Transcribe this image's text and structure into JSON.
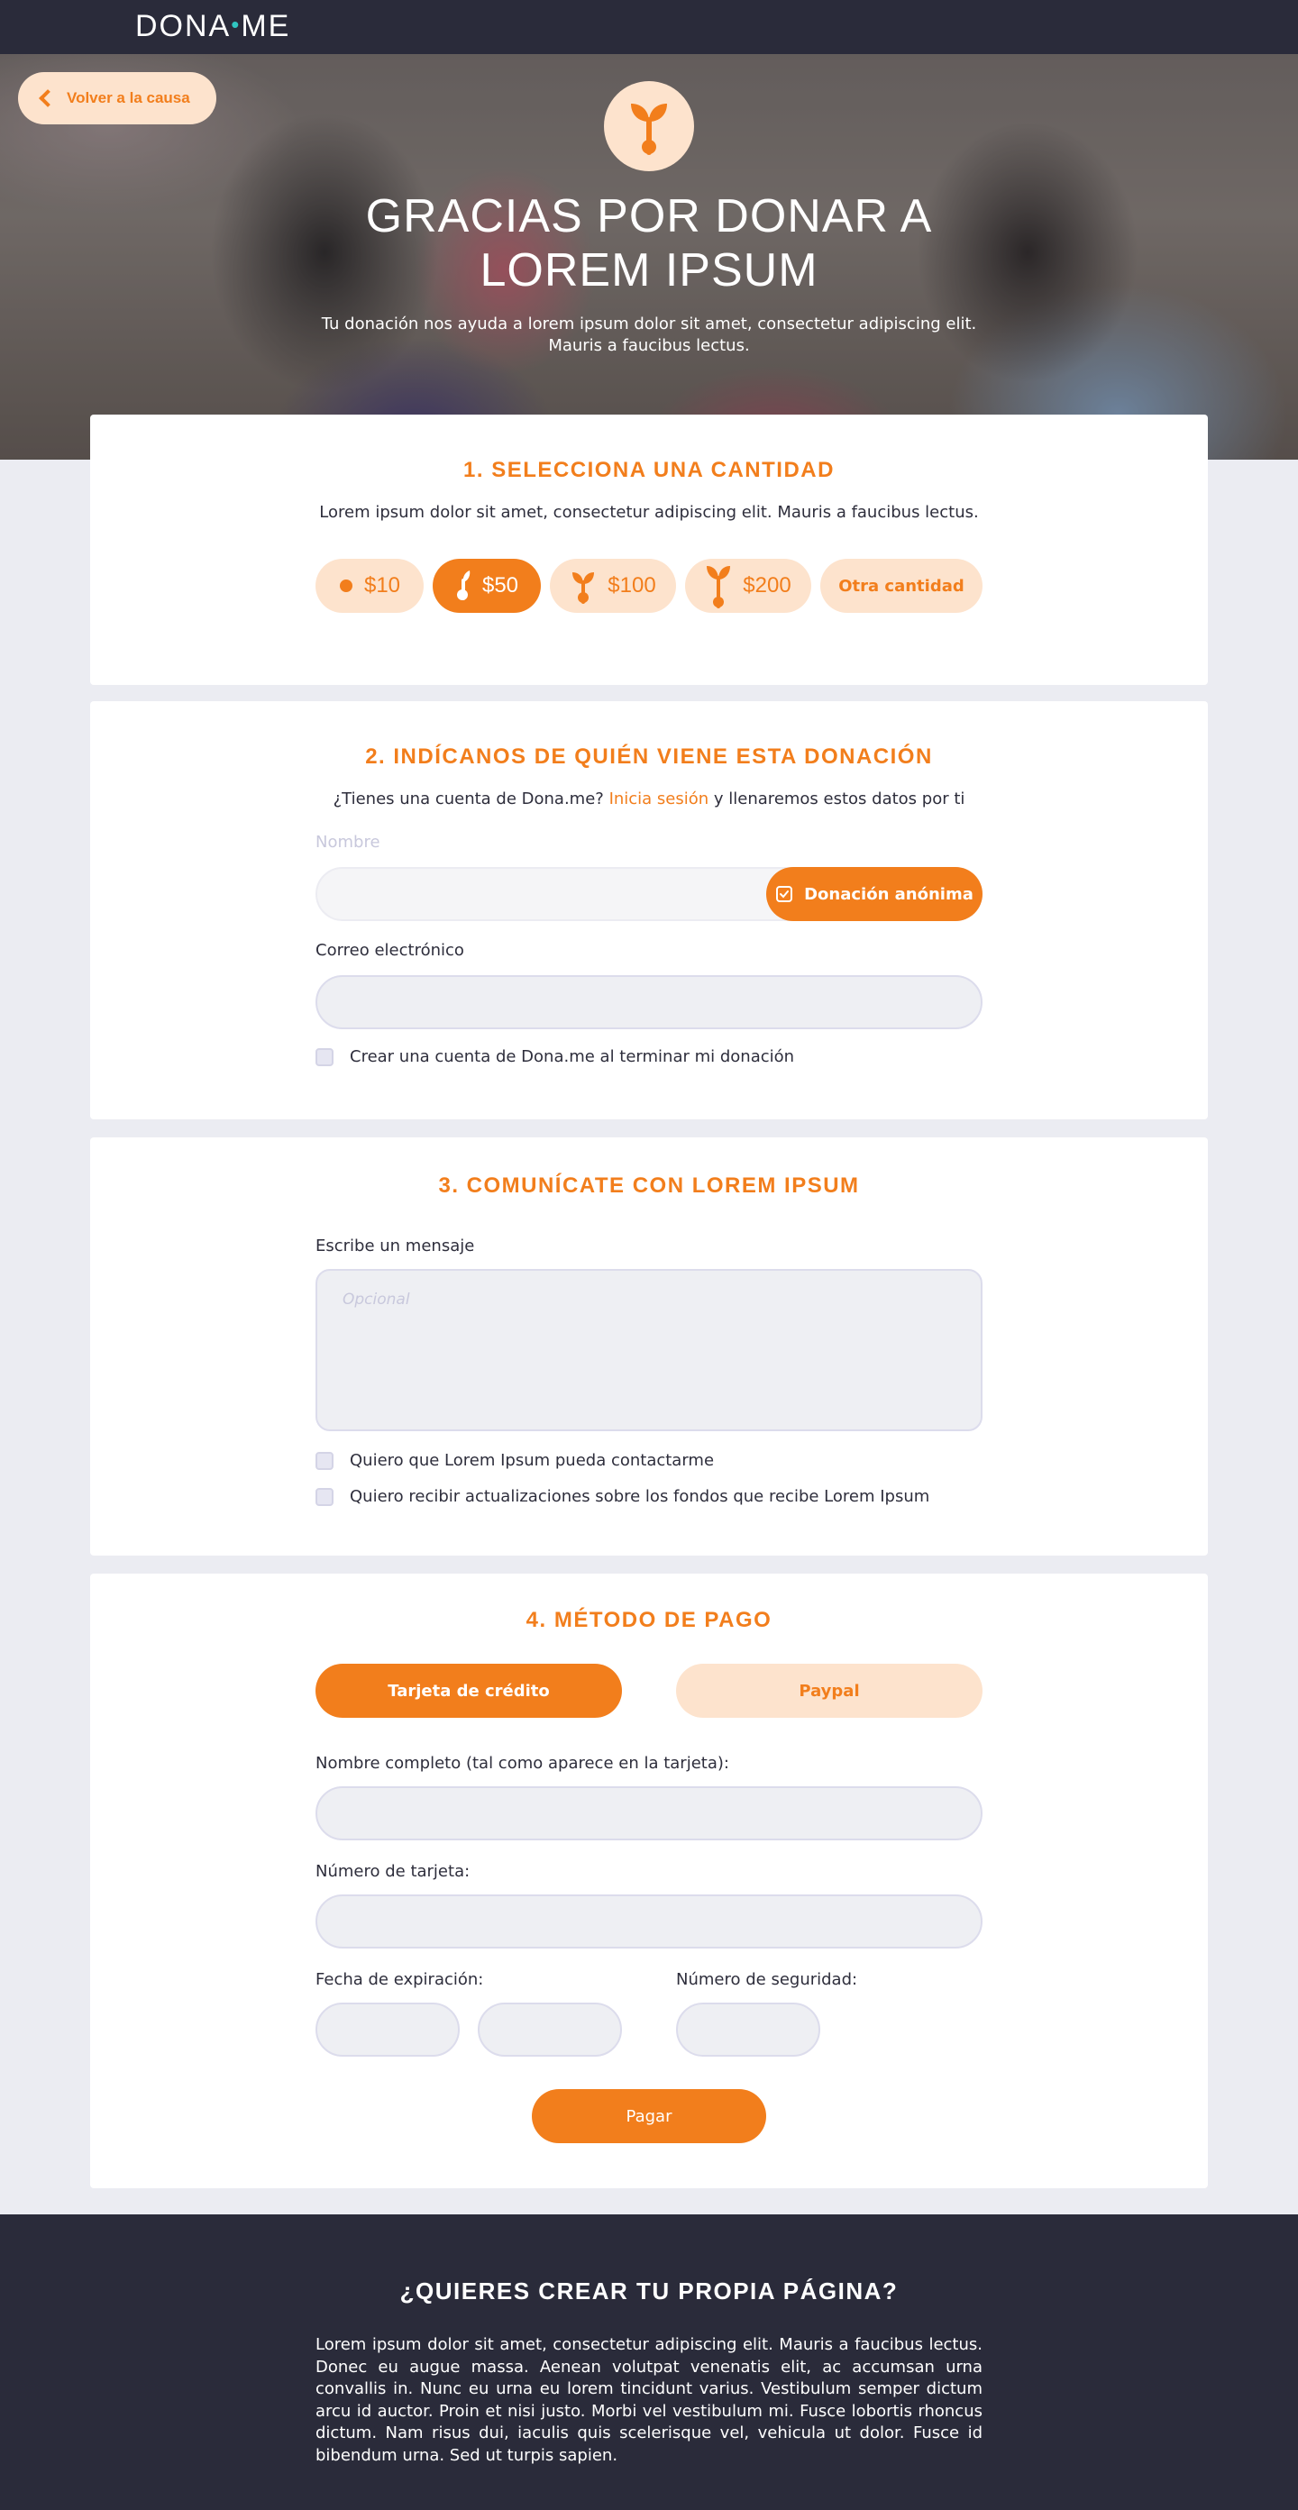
{
  "header": {
    "logo_left": "DONA",
    "logo_dot": "•",
    "logo_right": "ME"
  },
  "hero": {
    "back_label": "Volver a la causa",
    "title": "GRACIAS POR DONAR A LOREM IPSUM",
    "subtitle": "Tu donación nos ayuda a lorem ipsum dolor sit amet, consectetur adipiscing elit. Mauris a faucibus lectus."
  },
  "section1": {
    "title": "1. SELECCIONA UNA CANTIDAD",
    "text": "Lorem ipsum dolor sit amet, consectetur adipiscing elit. Mauris a faucibus lectus.",
    "amounts": [
      {
        "label": "$10",
        "icon": "seed-icon",
        "active": false
      },
      {
        "label": "$50",
        "icon": "sprout-icon",
        "active": true
      },
      {
        "label": "$100",
        "icon": "seedling-icon",
        "active": false
      },
      {
        "label": "$200",
        "icon": "plant-icon",
        "active": false
      }
    ],
    "other_label": "Otra cantidad"
  },
  "section2": {
    "title": "2. INDÍCANOS DE QUIÉN VIENE ESTA DONACIÓN",
    "question": "¿Tienes una cuenta de Dona.me?",
    "login_link": "Inicia sesión",
    "question_end": "y llenaremos estos datos por ti",
    "name_label": "Nombre",
    "anon_label": "Donación anónima",
    "email_label": "Correo electrónico",
    "create_account_label": "Crear una cuenta de Dona.me al terminar mi donación"
  },
  "section3": {
    "title": "3. COMUNÍCATE CON LOREM IPSUM",
    "message_label": "Escribe un mensaje",
    "message_placeholder": "Opcional",
    "contact_label": "Quiero que Lorem Ipsum pueda contactarme",
    "updates_label": "Quiero recibir actualizaciones sobre los fondos que recibe Lorem Ipsum"
  },
  "section4": {
    "title": "4. MÉTODO DE PAGO",
    "tab_card": "Tarjeta de crédito",
    "tab_paypal": "Paypal",
    "fullname_label": "Nombre completo (tal como aparece en la tarjeta):",
    "cardnumber_label": "Número de tarjeta:",
    "expiry_label": "Fecha de expiración:",
    "security_label": "Número de seguridad:",
    "pay_label": "Pagar"
  },
  "footer": {
    "title": "¿QUIERES CREAR TU PROPIA PÁGINA?",
    "text": "Lorem ipsum dolor sit amet, consectetur adipiscing elit. Mauris a faucibus lectus. Donec eu augue massa. Aenean volutpat venenatis elit, ac accumsan urna convallis in. Nunc eu urna eu lorem tincidunt varius. Vestibulum semper dictum arcu id auctor. Proin et nisi justo. Morbi vel vestibulum mi. Fusce lobortis rhoncus dictum. Nam risus dui, iaculis quis scelerisque vel, vehicula ut dolor. Fusce id bibendum urna. Sed ut turpis sapien."
  },
  "colors": {
    "accent": "#f27e1c",
    "accent_light": "#fde3cd",
    "dark": "#2a2b3a",
    "background": "#ebecf2"
  }
}
